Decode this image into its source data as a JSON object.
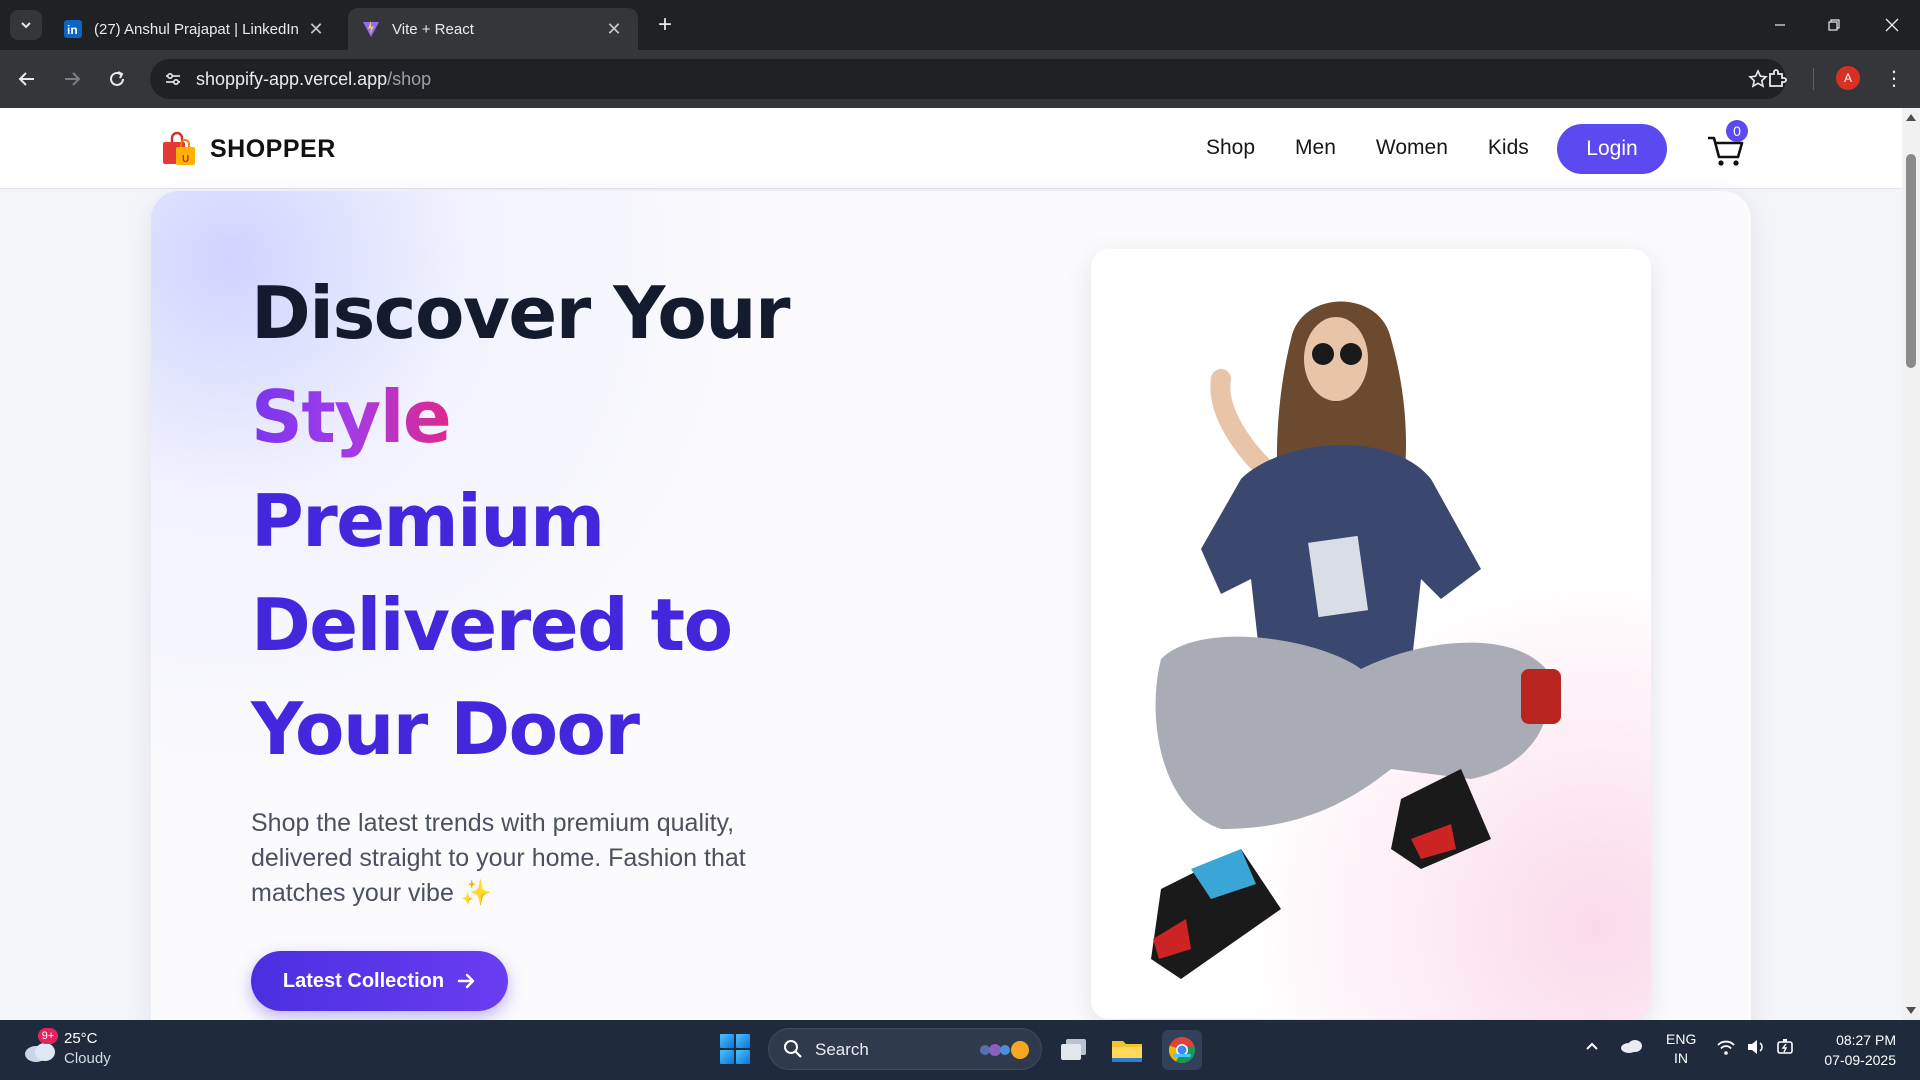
{
  "browser": {
    "tabs": [
      {
        "title": "(27) Anshul Prajapat | LinkedIn",
        "favicon": "linkedin-icon",
        "active": false
      },
      {
        "title": "Vite + React",
        "favicon": "vite-icon",
        "active": true
      }
    ],
    "url_host": "shoppify-app.vercel.app",
    "url_path": "/shop",
    "profile_initial": "A"
  },
  "site": {
    "brand": "SHOPPER",
    "nav": [
      "Shop",
      "Men",
      "Women",
      "Kids"
    ],
    "login_label": "Login",
    "cart_count": "0"
  },
  "hero": {
    "line1": "Discover Your",
    "line2": "Style",
    "line3": "Premium",
    "line4": "Delivered to",
    "line5": "Your Door",
    "description": "Shop the latest trends with premium quality, delivered straight to your home. Fashion that matches your vibe ✨",
    "cta_label": "Latest Collection"
  },
  "taskbar": {
    "weather_badge": "9+",
    "temperature": "25°C",
    "condition": "Cloudy",
    "search_label": "Search",
    "lang_line1": "ENG",
    "lang_line2": "IN",
    "time": "08:27 PM",
    "date": "07-09-2025"
  },
  "colors": {
    "accent": "#5b4af0",
    "hero_blue": "#4327dd",
    "gradient_start": "#7a36f0",
    "gradient_end": "#e0288c"
  }
}
